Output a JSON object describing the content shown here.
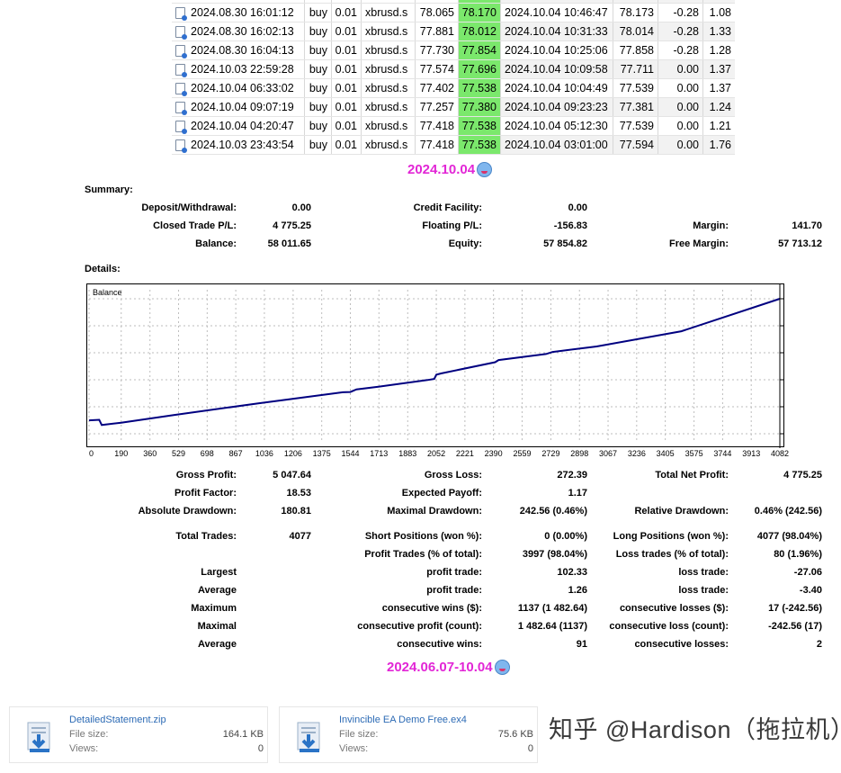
{
  "trades": [
    {
      "open_time": "2024.08.30 16:01:12",
      "type": "buy",
      "volume": "0.01",
      "symbol": "xbrusd.s",
      "open_price": "78.065",
      "sl": "78.170",
      "close_time": "2024.10.04 10:46:47",
      "close_price": "78.173",
      "swap": "-0.28",
      "profit": "1.08"
    },
    {
      "open_time": "2024.08.30 16:02:13",
      "type": "buy",
      "volume": "0.01",
      "symbol": "xbrusd.s",
      "open_price": "77.881",
      "sl": "78.012",
      "close_time": "2024.10.04 10:31:33",
      "close_price": "78.014",
      "swap": "-0.28",
      "profit": "1.33"
    },
    {
      "open_time": "2024.08.30 16:04:13",
      "type": "buy",
      "volume": "0.01",
      "symbol": "xbrusd.s",
      "open_price": "77.730",
      "sl": "77.854",
      "close_time": "2024.10.04 10:25:06",
      "close_price": "77.858",
      "swap": "-0.28",
      "profit": "1.28"
    },
    {
      "open_time": "2024.10.03 22:59:28",
      "type": "buy",
      "volume": "0.01",
      "symbol": "xbrusd.s",
      "open_price": "77.574",
      "sl": "77.696",
      "close_time": "2024.10.04 10:09:58",
      "close_price": "77.711",
      "swap": "0.00",
      "profit": "1.37"
    },
    {
      "open_time": "2024.10.04 06:33:02",
      "type": "buy",
      "volume": "0.01",
      "symbol": "xbrusd.s",
      "open_price": "77.402",
      "sl": "77.538",
      "close_time": "2024.10.04 10:04:49",
      "close_price": "77.539",
      "swap": "0.00",
      "profit": "1.37"
    },
    {
      "open_time": "2024.10.04 09:07:19",
      "type": "buy",
      "volume": "0.01",
      "symbol": "xbrusd.s",
      "open_price": "77.257",
      "sl": "77.380",
      "close_time": "2024.10.04 09:23:23",
      "close_price": "77.381",
      "swap": "0.00",
      "profit": "1.24"
    },
    {
      "open_time": "2024.10.04 04:20:47",
      "type": "buy",
      "volume": "0.01",
      "symbol": "xbrusd.s",
      "open_price": "77.418",
      "sl": "77.538",
      "close_time": "2024.10.04 05:12:30",
      "close_price": "77.539",
      "swap": "0.00",
      "profit": "1.21"
    },
    {
      "open_time": "2024.10.03 23:43:54",
      "type": "buy",
      "volume": "0.01",
      "symbol": "xbrusd.s",
      "open_price": "77.418",
      "sl": "77.538",
      "close_time": "2024.10.04 03:01:00",
      "close_price": "77.594",
      "swap": "0.00",
      "profit": "1.76"
    }
  ],
  "caption_top": "2024.10.04",
  "caption_bottom": "2024.06.07-10.04",
  "summary": {
    "label": "Summary:",
    "deposit_label": "Deposit/Withdrawal:",
    "deposit": "0.00",
    "credit_label": "Credit Facility:",
    "credit": "0.00",
    "closed_pl_label": "Closed Trade P/L:",
    "closed_pl": "4 775.25",
    "floating_label": "Floating P/L:",
    "floating": "-156.83",
    "margin_label": "Margin:",
    "margin": "141.70",
    "balance_label": "Balance:",
    "balance": "58 011.65",
    "equity_label": "Equity:",
    "equity": "57 854.82",
    "free_margin_label": "Free Margin:",
    "free_margin": "57 713.12"
  },
  "details_label": "Details:",
  "chart_data": {
    "type": "line",
    "title": "Balance",
    "x_ticks": [
      "0",
      "190",
      "360",
      "529",
      "698",
      "867",
      "1036",
      "1206",
      "1375",
      "1544",
      "1713",
      "1883",
      "2052",
      "2221",
      "2390",
      "2559",
      "2729",
      "2898",
      "3067",
      "3236",
      "3405",
      "3575",
      "3744",
      "3913",
      "4082"
    ],
    "y_ticks": [
      "57960",
      "56929",
      "55899",
      "54869",
      "53838",
      "52808"
    ],
    "xlim": [
      0,
      4082
    ],
    "ylim": [
      52808,
      57960
    ],
    "series": [
      {
        "name": "",
        "x": [
          0,
          60,
          75,
          190,
          500,
          1000,
          1500,
          1544,
          1580,
          1710,
          2000,
          2040,
          2052,
          2080,
          2400,
          2420,
          2700,
          2740,
          3000,
          3500,
          4082
        ],
        "y": [
          53320,
          53340,
          53140,
          53230,
          53520,
          53970,
          54390,
          54400,
          54500,
          54600,
          54860,
          54900,
          55060,
          55110,
          55540,
          55620,
          55850,
          55930,
          56140,
          56720,
          57960
        ]
      }
    ],
    "grid": true,
    "color": "#000080"
  },
  "stats": {
    "gross_profit_label": "Gross Profit:",
    "gross_profit": "5 047.64",
    "gross_loss_label": "Gross Loss:",
    "gross_loss": "272.39",
    "total_net_label": "Total Net Profit:",
    "total_net": "4 775.25",
    "profit_factor_label": "Profit Factor:",
    "profit_factor": "18.53",
    "expected_payoff_label": "Expected Payoff:",
    "expected_payoff": "1.17",
    "abs_dd_label": "Absolute Drawdown:",
    "abs_dd": "180.81",
    "max_dd_label": "Maximal Drawdown:",
    "max_dd": "242.56 (0.46%)",
    "rel_dd_label": "Relative Drawdown:",
    "rel_dd": "0.46% (242.56)",
    "total_trades_label": "Total Trades:",
    "total_trades": "4077",
    "short_label": "Short Positions (won %):",
    "short": "0 (0.00%)",
    "long_label": "Long Positions (won %):",
    "long": "4077 (98.04%)",
    "profit_trades_label": "Profit Trades (% of total):",
    "profit_trades": "3997 (98.04%)",
    "loss_trades_label": "Loss trades (% of total):",
    "loss_trades": "80 (1.96%)",
    "largest_label": "Largest",
    "largest_profit_label": "profit trade:",
    "largest_profit": "102.33",
    "largest_loss_label": "loss trade:",
    "largest_loss": "-27.06",
    "average_label": "Average",
    "average_profit_label": "profit trade:",
    "average_profit": "1.26",
    "average_loss_label": "loss trade:",
    "average_loss": "-3.40",
    "maximum_label": "Maximum",
    "max_wins_label": "consecutive wins ($):",
    "max_wins": "1137 (1 482.64)",
    "max_losses_label": "consecutive losses ($):",
    "max_losses": "17 (-242.56)",
    "maximal_label": "Maximal",
    "maximal_profit_label": "consecutive profit (count):",
    "maximal_profit": "1 482.64 (1137)",
    "maximal_loss_label": "consecutive loss (count):",
    "maximal_loss": "-242.56 (17)",
    "average2_label": "Average",
    "avg_cons_wins_label": "consecutive wins:",
    "avg_cons_wins": "91",
    "avg_cons_losses_label": "consecutive losses:",
    "avg_cons_losses": "2"
  },
  "attachments": [
    {
      "name": "DetailedStatement.zip",
      "size_label": "File size:",
      "size": "164.1 KB",
      "views_label": "Views:",
      "views": "0"
    },
    {
      "name": "Invincible EA Demo Free.ex4",
      "size_label": "File size:",
      "size": "75.6 KB",
      "views_label": "Views:",
      "views": "0"
    }
  ],
  "watermark": "知乎 @Hardison（拖拉机）"
}
